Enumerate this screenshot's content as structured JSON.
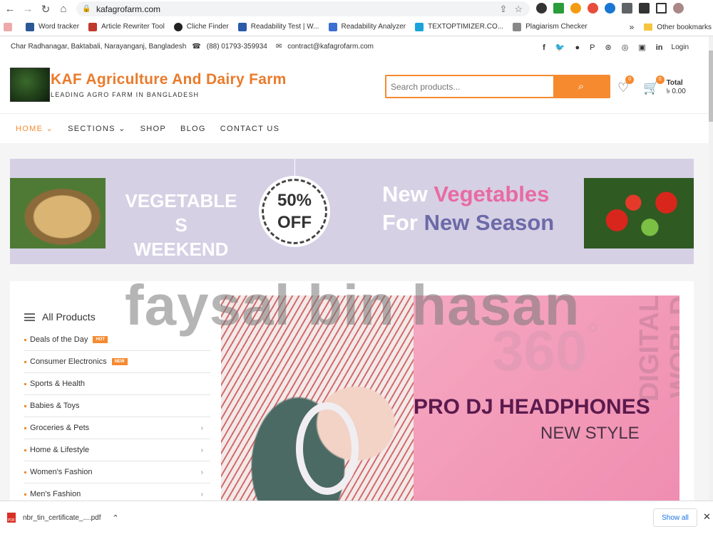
{
  "browser": {
    "url": "kafagrofarm.com",
    "bookmarks": [
      {
        "label": "Word tracker",
        "color": "#2b5797"
      },
      {
        "label": "Article Rewriter Tool",
        "color": "#c0392b"
      },
      {
        "label": "Cliche Finder",
        "color": "#222222"
      },
      {
        "label": "Readability Test | W...",
        "color": "#2a5aa8"
      },
      {
        "label": "Readability Analyzer",
        "color": "#3b6fd1"
      },
      {
        "label": "TEXTOPTIMIZER.CO...",
        "color": "#1ba3d9"
      },
      {
        "label": "Plagiarism Checker",
        "color": "#888888"
      }
    ],
    "more": "»",
    "other_bookmarks": "Other bookmarks"
  },
  "topbar": {
    "address": "Char Radhanagar, Baktabali, Narayanganj, Bangladesh",
    "phone": "(88) 01793-359934",
    "email": "contract@kafagrofarm.com",
    "login": "Login",
    "social": [
      "f",
      "🐦",
      "●",
      "P",
      "⊛",
      "◎",
      "▣",
      "in"
    ]
  },
  "header": {
    "title": "KAF Agriculture And Dairy Farm",
    "subtitle": "LEADING AGRO FARM IN BANGLADESH",
    "search_placeholder": "Search products...",
    "wishlist_count": "0",
    "cart_count": "0",
    "total_label": "Total",
    "total_value": "৳ 0.00"
  },
  "nav": {
    "items": [
      {
        "label": "HOME ⌄",
        "active": true
      },
      {
        "label": "SECTIONS ⌄"
      },
      {
        "label": "SHOP"
      },
      {
        "label": "BLOG"
      },
      {
        "label": "CONTACT US"
      }
    ]
  },
  "banner": {
    "left_line1": "VEGETABLE S",
    "left_line2": "WEEKEND",
    "discount": "50%",
    "off": "OFF",
    "new1": "New",
    "new2": "Vegetables",
    "new3": "For",
    "new4": "New Season"
  },
  "sidebar": {
    "title": "All Products",
    "items": [
      {
        "label": "Deals of the Day",
        "tag": "HOT"
      },
      {
        "label": "Consumer Electronics",
        "tag": "NEW"
      },
      {
        "label": "Sports & Health"
      },
      {
        "label": "Babies & Toys"
      },
      {
        "label": "Groceries & Pets",
        "chev": "›"
      },
      {
        "label": "Home & Lifestyle",
        "chev": "›"
      },
      {
        "label": "Women's Fashion",
        "chev": "›"
      },
      {
        "label": "Men's Fashion",
        "chev": "›"
      }
    ]
  },
  "hero": {
    "big": "360",
    "degree": "°",
    "vertical": "DIGITAL WORLD",
    "headline": "PRO DJ HEADPHONES",
    "subline": "NEW STYLE"
  },
  "watermark": "faysal bin hasan",
  "download": {
    "file": "nbr_tin_certificate_....pdf",
    "show_all": "Show all"
  }
}
